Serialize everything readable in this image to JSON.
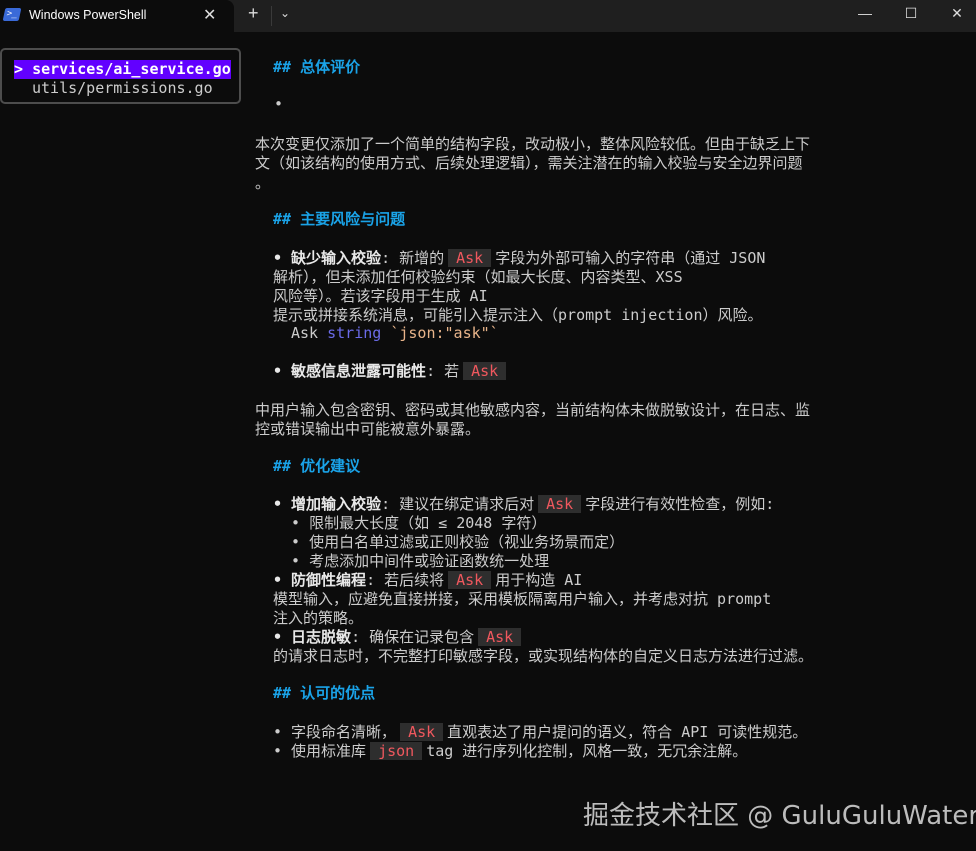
{
  "window": {
    "title": "Windows PowerShell",
    "close_tab": "✕",
    "new_tab": "+",
    "dropdown": "⌄",
    "minimize": "—",
    "maximize": "☐",
    "close": "✕"
  },
  "sidebar": {
    "selected_prefix": "> ",
    "files": [
      "services/ai_service.go",
      "utils/permissions.go"
    ]
  },
  "s1": {
    "heading": "## 总体评价",
    "bullet": "•",
    "para": [
      "本次变更仅添加了一个简单的结构字段，改动极小，整体风险较低。但由于缺乏上下",
      "文（如该结构的使用方式、后续处理逻辑），需关注潜在的输入校验与安全边界问题",
      "。"
    ]
  },
  "s2": {
    "heading": "## 主要风险与问题",
    "item1": {
      "title": "• 缺少输入校验",
      "pre": ": 新增的",
      "code": "Ask",
      "post": "字段为外部可输入的字符串（通过 JSON",
      "lines": [
        "解析），但未添加任何校验约束（如最大长度、内容类型、XSS",
        "风险等）。若该字段用于生成 AI",
        "提示或拼接系统消息，可能引入提示注入（prompt injection）风险。"
      ],
      "code_line": {
        "ident": "Ask ",
        "type": "string",
        "tag": " `json:\"ask\"`"
      }
    },
    "item2": {
      "title": "• 敏感信息泄露可能性",
      "pre": ": 若",
      "code": "Ask"
    },
    "para": [
      "中用户输入包含密钥、密码或其他敏感内容，当前结构体未做脱敏设计，在日志、监",
      "控或错误输出中可能被意外暴露。"
    ]
  },
  "s3": {
    "heading": "## 优化建议",
    "item1": {
      "title": "• 增加输入校验",
      "pre": ": 建议在绑定请求后对",
      "code": "Ask",
      "post": "字段进行有效性检查，例如:",
      "subs": [
        "  • 限制最大长度（如 ≤ 2048 字符）",
        "  • 使用白名单过滤或正则校验（视业务场景而定）",
        "  • 考虑添加中间件或验证函数统一处理"
      ]
    },
    "item2": {
      "title": "• 防御性编程",
      "pre": ": 若后续将",
      "code": "Ask",
      "post": "用于构造 AI",
      "lines": [
        "模型输入，应避免直接拼接，采用模板隔离用户输入，并考虑对抗 prompt",
        "注入的策略。"
      ]
    },
    "item3": {
      "title": "• 日志脱敏",
      "pre": ": 确保在记录包含",
      "code": "Ask",
      "lines": [
        "的请求日志时，不完整打印敏感字段，或实现结构体的自定义日志方法进行过滤。"
      ]
    }
  },
  "s4": {
    "heading": "## 认可的优点",
    "item1": {
      "pre": "• 字段命名清晰，",
      "code": "Ask",
      "post": "直观表达了用户提问的语义，符合 API 可读性规范。"
    },
    "item2": {
      "pre": "• 使用标准库",
      "code": "json",
      "post": "tag 进行序列化控制，风格一致，无冗余注解。"
    }
  },
  "watermark": "掘金技术社区 @ GuluGuluWater"
}
